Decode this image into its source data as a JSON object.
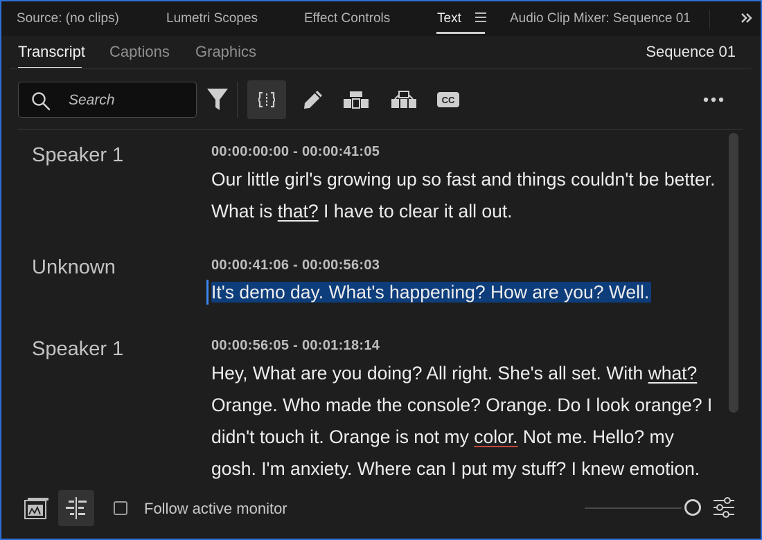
{
  "panel_tabs": [
    {
      "label": "Source: (no clips)"
    },
    {
      "label": "Lumetri Scopes"
    },
    {
      "label": "Effect Controls"
    },
    {
      "label": "Text"
    },
    {
      "label": "Audio Clip Mixer: Sequence 01"
    }
  ],
  "sub_tabs": [
    {
      "label": "Transcript"
    },
    {
      "label": "Captions"
    },
    {
      "label": "Graphics"
    }
  ],
  "sequence_name": "Sequence 01",
  "search": {
    "placeholder": "Search",
    "value": ""
  },
  "transcript": [
    {
      "speaker": "Speaker 1",
      "timecode": "00:00:00:00 - 00:00:41:05",
      "text_parts": [
        "Our little girl's growing up so fast and things couldn't be better. What is ",
        "that?",
        " I have to clear it all out."
      ]
    },
    {
      "speaker": "Unknown",
      "timecode": "00:00:41:06 - 00:00:56:03",
      "text": "It's demo day. What's happening? How are you? Well."
    },
    {
      "speaker": "Speaker 1",
      "timecode": "00:00:56:05 - 00:01:18:14",
      "text_parts": [
        "Hey, What are you doing? All right. She's all set. With ",
        "what?",
        " Orange. Who made the console? Orange. Do I look orange? I didn't touch it. Orange is not my ",
        "color.",
        " Not me. Hello? my gosh. I'm anxiety. Where can I put my stuff? I knew emotion."
      ]
    }
  ],
  "footer": {
    "follow_active_monitor_label": "Follow active monitor",
    "follow_active_monitor_checked": false
  },
  "colors": {
    "selection": "#0e3d7b",
    "focus_border": "#2d6fd8",
    "caret": "#3c86f0",
    "underline_flag": "#c24a3e"
  },
  "icons": [
    "search-icon",
    "filter-icon",
    "split-segment-icon",
    "edit-pencil-icon",
    "merge-up-icon",
    "merge-down-icon",
    "closed-captions-icon",
    "more-options-icon",
    "hamburger-menu-icon",
    "overflow-chevrons-icon",
    "media-browser-icon",
    "align-segments-icon",
    "settings-sliders-icon"
  ]
}
